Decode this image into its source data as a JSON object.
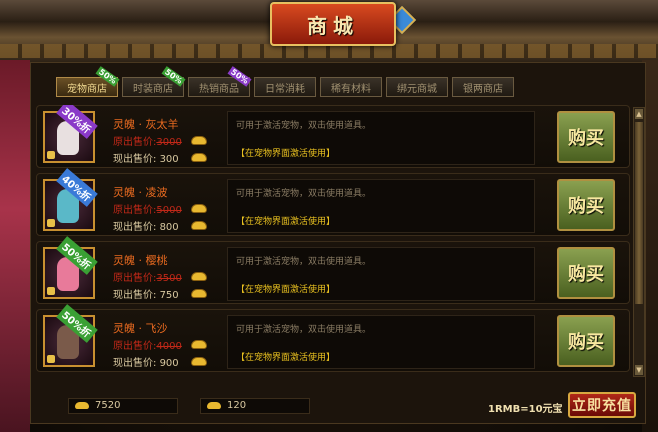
{
  "window": {
    "title": "商城"
  },
  "tabs": [
    {
      "label": "宠物商店",
      "badge": "50%",
      "active": true
    },
    {
      "label": "时装商店",
      "badge": "50%"
    },
    {
      "label": "热销商品",
      "badge": "50%"
    },
    {
      "label": "日常消耗"
    },
    {
      "label": "稀有材料"
    },
    {
      "label": "绑元商城"
    },
    {
      "label": "银两商店"
    }
  ],
  "items": [
    {
      "name": "灵魄 · 灰太羊",
      "old_label": "原出售价:",
      "old_price": "3000",
      "now_label": "现出售价:",
      "now_price": "300",
      "discount": "30%折",
      "desc": "可用于激活宠物，双击使用道具。",
      "desc2": "【在宠物界面激活使用】",
      "buy": "购买",
      "pet_color": "#e8e0e0",
      "disc_color": "#8a3ac8"
    },
    {
      "name": "灵魄 · 凌波",
      "old_label": "原出售价:",
      "old_price": "5000",
      "now_label": "现出售价:",
      "now_price": "800",
      "discount": "40%折",
      "desc": "可用于激活宠物，双击使用道具。",
      "desc2": "【在宠物界面激活使用】",
      "buy": "购买",
      "pet_color": "#5ab8c8",
      "disc_color": "#3a7ad8"
    },
    {
      "name": "灵魄 · 樱桃",
      "old_label": "原出售价:",
      "old_price": "3500",
      "now_label": "现出售价:",
      "now_price": "750",
      "discount": "50%折",
      "desc": "可用于激活宠物，双击使用道具。",
      "desc2": "【在宠物界面激活使用】",
      "buy": "购买",
      "pet_color": "#e87a9a",
      "disc_color": "#3aa034"
    },
    {
      "name": "灵魄 · 飞沙",
      "old_label": "原出售价:",
      "old_price": "4000",
      "now_label": "现出售价:",
      "now_price": "900",
      "discount": "50%折",
      "desc": "可用于激活宠物，双击使用道具。",
      "desc2": "【在宠物界面激活使用】",
      "buy": "购买",
      "pet_color": "#7a5a4a",
      "disc_color": "#3aa034"
    }
  ],
  "footer": {
    "gold": "7520",
    "bound_gold": "120",
    "rate": "1RMB=10元宝",
    "recharge": "立即充值"
  }
}
